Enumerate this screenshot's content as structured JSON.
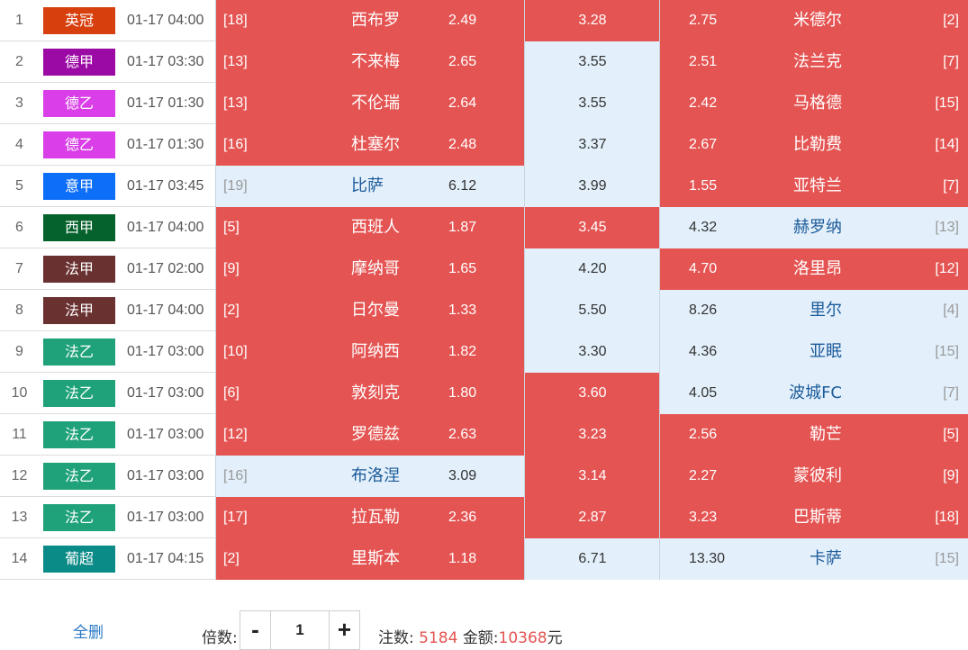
{
  "colors": {
    "highlight": "#e45452",
    "normal": "#e3f0fb",
    "leagues": {
      "英冠": "#d73f0c",
      "德甲": "#9c0aa5",
      "德乙": "#d93ee8",
      "意甲": "#0d6ef8",
      "西甲": "#05622c",
      "法甲": "#6a3131",
      "法乙": "#1fa27a",
      "葡超": "#0b8b87"
    }
  },
  "rows": [
    {
      "num": "1",
      "league": "英冠",
      "time": "01-17 04:00",
      "home_rank": "[18]",
      "home": "西布罗",
      "home_odds": "2.49",
      "draw_odds": "3.28",
      "away_odds": "2.75",
      "away": "米德尔",
      "away_rank": "[2]",
      "sel": [
        true,
        true,
        true
      ]
    },
    {
      "num": "2",
      "league": "德甲",
      "time": "01-17 03:30",
      "home_rank": "[13]",
      "home": "不来梅",
      "home_odds": "2.65",
      "draw_odds": "3.55",
      "away_odds": "2.51",
      "away": "法兰克",
      "away_rank": "[7]",
      "sel": [
        true,
        false,
        true
      ]
    },
    {
      "num": "3",
      "league": "德乙",
      "time": "01-17 01:30",
      "home_rank": "[13]",
      "home": "不伦瑞",
      "home_odds": "2.64",
      "draw_odds": "3.55",
      "away_odds": "2.42",
      "away": "马格德",
      "away_rank": "[15]",
      "sel": [
        true,
        false,
        true
      ]
    },
    {
      "num": "4",
      "league": "德乙",
      "time": "01-17 01:30",
      "home_rank": "[16]",
      "home": "杜塞尔",
      "home_odds": "2.48",
      "draw_odds": "3.37",
      "away_odds": "2.67",
      "away": "比勒费",
      "away_rank": "[14]",
      "sel": [
        true,
        false,
        true
      ]
    },
    {
      "num": "5",
      "league": "意甲",
      "time": "01-17 03:45",
      "home_rank": "[19]",
      "home": "比萨",
      "home_odds": "6.12",
      "draw_odds": "3.99",
      "away_odds": "1.55",
      "away": "亚特兰",
      "away_rank": "[7]",
      "sel": [
        false,
        false,
        true
      ]
    },
    {
      "num": "6",
      "league": "西甲",
      "time": "01-17 04:00",
      "home_rank": "[5]",
      "home": "西班人",
      "home_odds": "1.87",
      "draw_odds": "3.45",
      "away_odds": "4.32",
      "away": "赫罗纳",
      "away_rank": "[13]",
      "sel": [
        true,
        true,
        false
      ]
    },
    {
      "num": "7",
      "league": "法甲",
      "time": "01-17 02:00",
      "home_rank": "[9]",
      "home": "摩纳哥",
      "home_odds": "1.65",
      "draw_odds": "4.20",
      "away_odds": "4.70",
      "away": "洛里昂",
      "away_rank": "[12]",
      "sel": [
        true,
        false,
        true
      ]
    },
    {
      "num": "8",
      "league": "法甲",
      "time": "01-17 04:00",
      "home_rank": "[2]",
      "home": "日尔曼",
      "home_odds": "1.33",
      "draw_odds": "5.50",
      "away_odds": "8.26",
      "away": "里尔",
      "away_rank": "[4]",
      "sel": [
        true,
        false,
        false
      ]
    },
    {
      "num": "9",
      "league": "法乙",
      "time": "01-17 03:00",
      "home_rank": "[10]",
      "home": "阿纳西",
      "home_odds": "1.82",
      "draw_odds": "3.30",
      "away_odds": "4.36",
      "away": "亚眠",
      "away_rank": "[15]",
      "sel": [
        true,
        false,
        false
      ]
    },
    {
      "num": "10",
      "league": "法乙",
      "time": "01-17 03:00",
      "home_rank": "[6]",
      "home": "敦刻克",
      "home_odds": "1.80",
      "draw_odds": "3.60",
      "away_odds": "4.05",
      "away": "波城FC",
      "away_rank": "[7]",
      "sel": [
        true,
        true,
        false
      ]
    },
    {
      "num": "11",
      "league": "法乙",
      "time": "01-17 03:00",
      "home_rank": "[12]",
      "home": "罗德兹",
      "home_odds": "2.63",
      "draw_odds": "3.23",
      "away_odds": "2.56",
      "away": "勒芒",
      "away_rank": "[5]",
      "sel": [
        true,
        true,
        true
      ]
    },
    {
      "num": "12",
      "league": "法乙",
      "time": "01-17 03:00",
      "home_rank": "[16]",
      "home": "布洛涅",
      "home_odds": "3.09",
      "draw_odds": "3.14",
      "away_odds": "2.27",
      "away": "蒙彼利",
      "away_rank": "[9]",
      "sel": [
        false,
        true,
        true
      ]
    },
    {
      "num": "13",
      "league": "法乙",
      "time": "01-17 03:00",
      "home_rank": "[17]",
      "home": "拉瓦勒",
      "home_odds": "2.36",
      "draw_odds": "2.87",
      "away_odds": "3.23",
      "away": "巴斯蒂",
      "away_rank": "[18]",
      "sel": [
        true,
        true,
        true
      ]
    },
    {
      "num": "14",
      "league": "葡超",
      "time": "01-17 04:15",
      "home_rank": "[2]",
      "home": "里斯本",
      "home_odds": "1.18",
      "draw_odds": "6.71",
      "away_odds": "13.30",
      "away": "卡萨",
      "away_rank": "[15]",
      "sel": [
        true,
        false,
        false
      ]
    }
  ],
  "footer": {
    "clear_all": "全删",
    "multiplier_label": "倍数:",
    "minus": "-",
    "multiplier": "1",
    "plus": "+",
    "bets_label": "注数:",
    "bets": "5184",
    "amount_label": "金额:",
    "amount": "10368",
    "currency": "元"
  }
}
